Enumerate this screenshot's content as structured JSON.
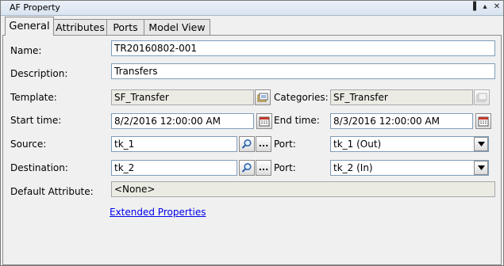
{
  "window": {
    "title": "AF Property",
    "pin_glyph": "▐",
    "restore_glyph": "▴",
    "close_glyph": "✕"
  },
  "tabs": [
    {
      "label": "General",
      "active": true
    },
    {
      "label": "Attributes",
      "active": false
    },
    {
      "label": "Ports",
      "active": false
    },
    {
      "label": "Model View",
      "active": false
    }
  ],
  "form": {
    "name": {
      "label": "Name:",
      "value": "TR20160802-001"
    },
    "description": {
      "label": "Description:",
      "value": "Transfers"
    },
    "template": {
      "label": "Template:",
      "value": "SF_Transfer"
    },
    "categories": {
      "label": "Categories:",
      "value": "SF_Transfer"
    },
    "start_time": {
      "label": "Start time:",
      "value": "8/2/2016 12:00:00 AM"
    },
    "end_time": {
      "label": "End time:",
      "value": "8/3/2016 12:00:00 AM"
    },
    "source": {
      "label": "Source:",
      "value": "tk_1",
      "browse_label": "..."
    },
    "source_port": {
      "label": "Port:",
      "value": "tk_1 (Out)"
    },
    "destination": {
      "label": "Destination:",
      "value": "tk_2",
      "browse_label": "..."
    },
    "destination_port": {
      "label": "Port:",
      "value": "tk_2 (In)"
    },
    "default_attribute": {
      "label": "Default Attribute:",
      "value": "<None>"
    }
  },
  "links": {
    "extended_properties": "Extended Properties"
  },
  "colors": {
    "link": "#0000ee",
    "input_border": "#7f9db9",
    "readonly_bg": "#ebebe4",
    "calendar_red": "#c0392b"
  },
  "icons": [
    "pin-icon",
    "restore-icon",
    "close-icon",
    "template-picker-icon",
    "categories-picker-icon",
    "calendar-icon",
    "search-icon",
    "chevron-down-icon"
  ]
}
